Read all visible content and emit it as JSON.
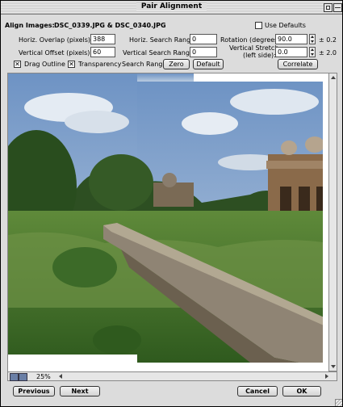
{
  "window": {
    "title": "Pair Alignment"
  },
  "header": {
    "label": "Align Images:",
    "files": "DSC_0339.JPG & DSC_0340.JPG",
    "use_defaults_label": "Use Defaults"
  },
  "params": {
    "horiz_overlap_label": "Horiz. Overlap (pixels):",
    "horiz_overlap_value": "388",
    "vertical_offset_label": "Vertical Offset (pixels):",
    "vertical_offset_value": "60",
    "horiz_search_label": "Horiz. Search Range:",
    "horiz_search_value": "0",
    "vertical_search_label": "Vertical Search Range:",
    "vertical_search_value": "0",
    "rotation_label": "Rotation (degrees):",
    "rotation_value": "90.0",
    "rotation_range": "± 0.2",
    "vstretch_label_1": "Vertical Stretch",
    "vstretch_label_2": "(left side):",
    "vstretch_value": "0.0",
    "vstretch_range": "± 2.0"
  },
  "options": {
    "drag_outline": "Drag Outline",
    "transparency": "Transparency",
    "search_range_label": "Search Range:",
    "zero": "Zero",
    "default": "Default",
    "correlate": "Correlate"
  },
  "status": {
    "zoom": "25%"
  },
  "footer": {
    "previous": "Previous",
    "next": "Next",
    "cancel": "Cancel",
    "ok": "OK"
  }
}
